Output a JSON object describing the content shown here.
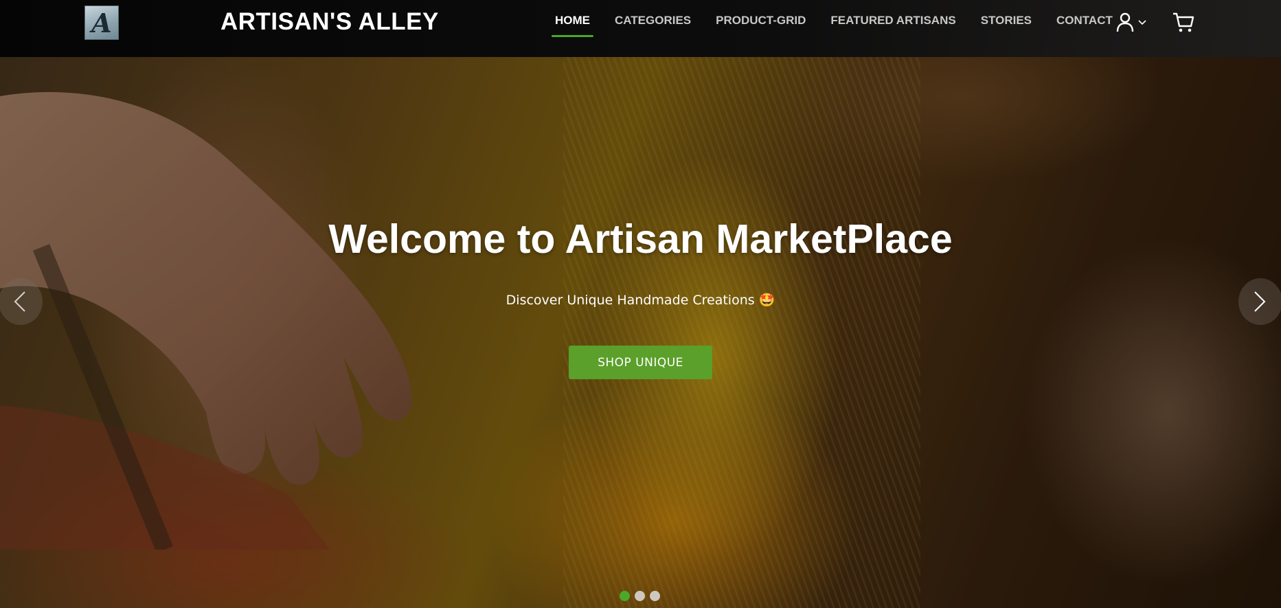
{
  "brand": {
    "logo_letter": "A",
    "name": "ARTISAN'S ALLEY"
  },
  "nav": {
    "items": [
      {
        "label": "HOME",
        "active": true
      },
      {
        "label": "CATEGORIES",
        "active": false
      },
      {
        "label": "PRODUCT-GRID",
        "active": false
      },
      {
        "label": "FEATURED ARTISANS",
        "active": false
      },
      {
        "label": "STORIES",
        "active": false
      },
      {
        "label": "CONTACT",
        "active": false
      }
    ],
    "user_icon": "user-icon",
    "dropdown_icon": "chevron-down-icon",
    "cart_icon": "cart-icon"
  },
  "hero": {
    "title": "Welcome to Artisan MarketPlace",
    "subtitle": "Discover Unique Handmade Creations 🤩",
    "cta_label": "SHOP UNIQUE",
    "slide_count": 3,
    "active_slide": 1
  },
  "colors": {
    "accent": "#4aa82a",
    "button": "#5aa02a",
    "navbar": "#0a0a0a",
    "text": "#ffffff"
  }
}
